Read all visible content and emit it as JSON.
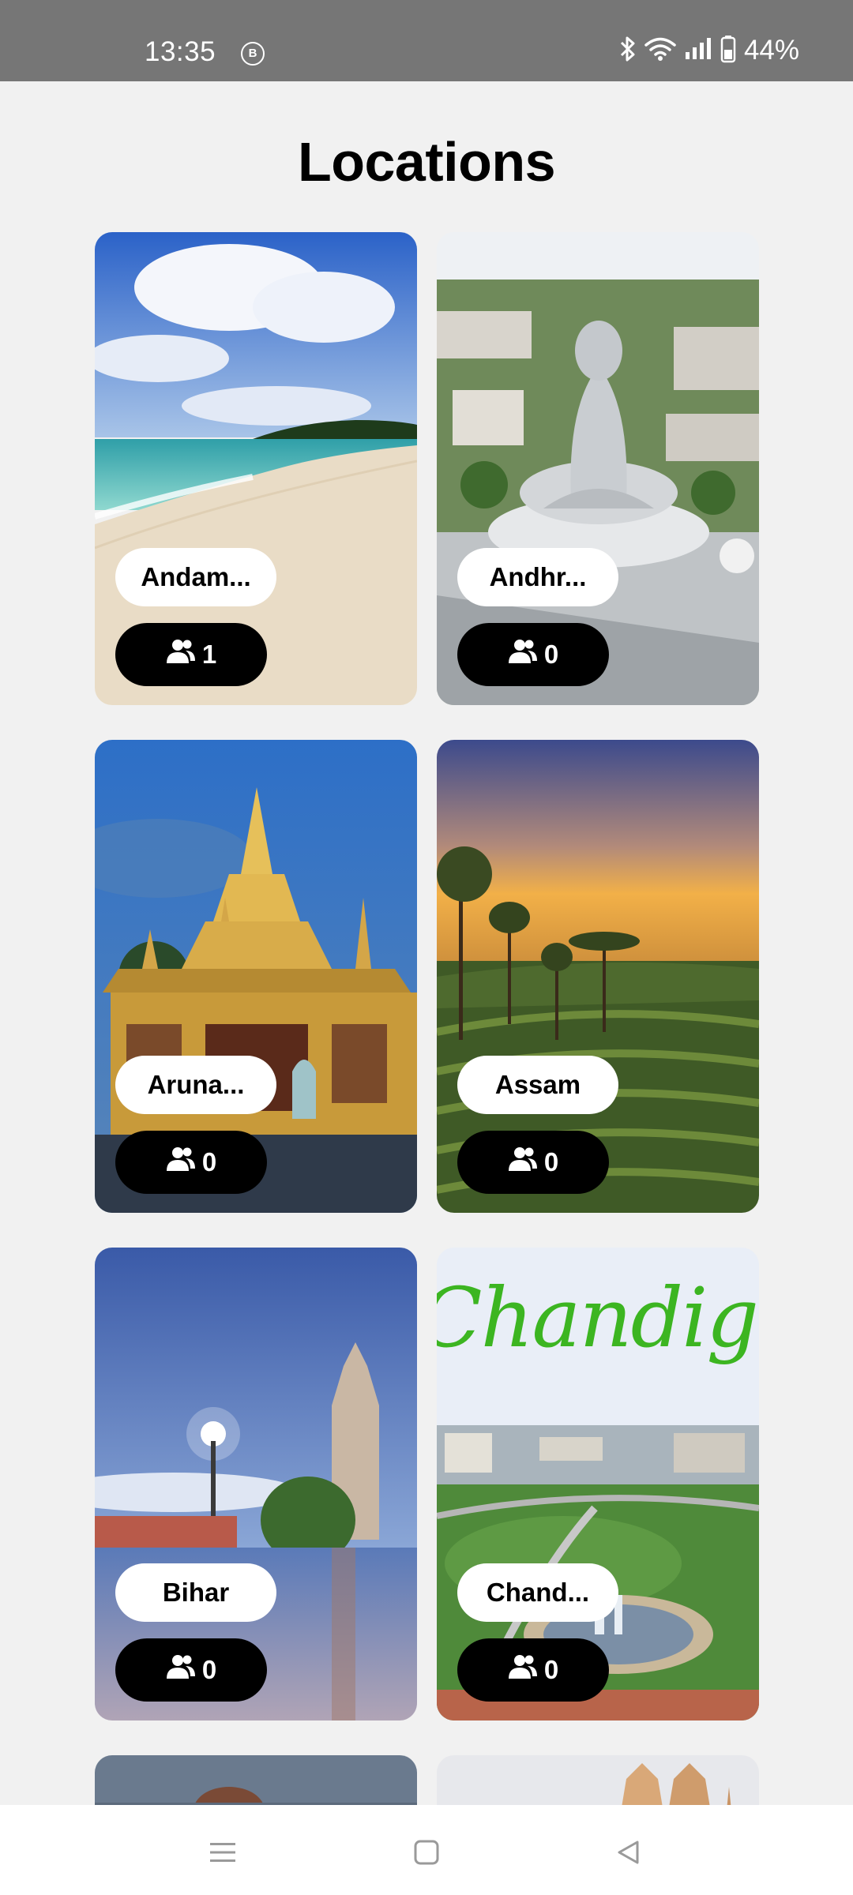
{
  "status_bar": {
    "time": "13:35",
    "badge": "B",
    "battery": "44%"
  },
  "page": {
    "title": "Locations"
  },
  "locations": [
    {
      "name": "Andam...",
      "count": "1"
    },
    {
      "name": "Andhr...",
      "count": "0"
    },
    {
      "name": "Aruna...",
      "count": "0"
    },
    {
      "name": "Assam",
      "count": "0"
    },
    {
      "name": "Bihar",
      "count": "0"
    },
    {
      "name": "Chand...",
      "count": "0"
    }
  ],
  "chandigarh_banner": "Chandigarh",
  "icons": {
    "count": "users-icon",
    "nav_menu": "menu-icon",
    "nav_home": "home-square-icon",
    "nav_back": "back-triangle-icon"
  },
  "colors": {
    "status_bar": "#767676",
    "background": "#f1f1f1",
    "pill_dark": "#000000",
    "pill_light": "#ffffff",
    "banner_green": "#3cb521"
  }
}
